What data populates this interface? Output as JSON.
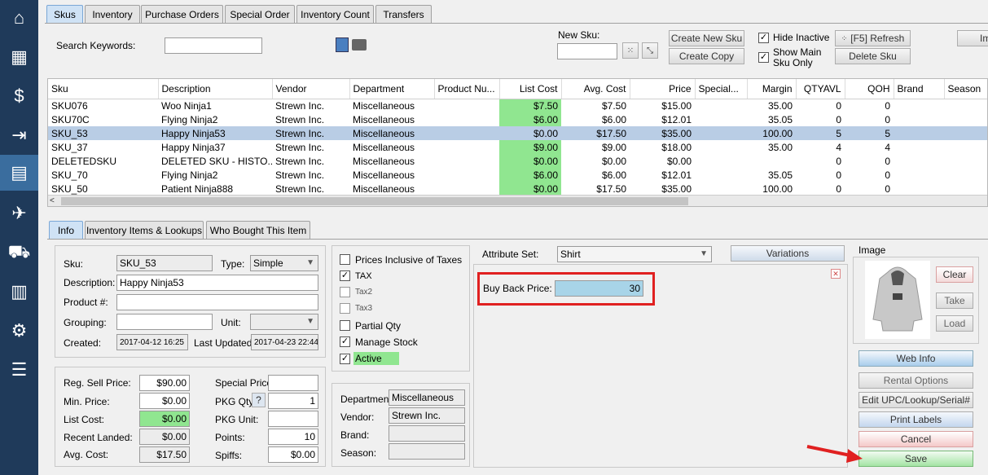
{
  "sidebar": {
    "items": [
      {
        "icon": "home-icon"
      },
      {
        "icon": "cash-register-icon"
      },
      {
        "icon": "invoice-icon"
      },
      {
        "icon": "sign-out-icon"
      },
      {
        "icon": "inventory-grid-icon"
      },
      {
        "icon": "walking-person-icon"
      },
      {
        "icon": "delivery-cart-icon"
      },
      {
        "icon": "report-icon"
      },
      {
        "icon": "settings-gears-icon"
      },
      {
        "icon": "menu-icon"
      }
    ]
  },
  "top_tabs": [
    "Skus",
    "Inventory",
    "Purchase Orders",
    "Special Order",
    "Inventory Count",
    "Transfers"
  ],
  "search": {
    "label": "Search Keywords:",
    "value": ""
  },
  "new_sku": {
    "label": "New Sku:",
    "value": ""
  },
  "toolbar": {
    "create_new_sku": "Create New Sku",
    "create_copy": "Create Copy",
    "hide_inactive": "Hide Inactive",
    "show_main_line1": "Show Main",
    "show_main_line2": "Sku Only",
    "refresh": "[F5] Refresh",
    "delete_sku": "Delete Sku",
    "import": "Imp"
  },
  "grid": {
    "columns": [
      "Sku",
      "Description",
      "Vendor",
      "Department",
      "Product Nu...",
      "List Cost",
      "Avg. Cost",
      "Price",
      "Special...",
      "Margin",
      "QTYAVL",
      "QOH",
      "Brand",
      "Season"
    ],
    "rows": [
      [
        "SKU076",
        "Woo Ninja1",
        "Strewn Inc.",
        "Miscellaneous",
        "",
        "$7.50",
        "$7.50",
        "$15.00",
        "",
        "35.00",
        "0",
        "0",
        "",
        ""
      ],
      [
        "SKU70C",
        "Flying Ninja2",
        "Strewn Inc.",
        "Miscellaneous",
        "",
        "$6.00",
        "$6.00",
        "$12.01",
        "",
        "35.05",
        "0",
        "0",
        "",
        ""
      ],
      [
        "SKU_53",
        "Happy Ninja53",
        "Strewn Inc.",
        "Miscellaneous",
        "",
        "$0.00",
        "$17.50",
        "$35.00",
        "",
        "100.00",
        "5",
        "5",
        "",
        ""
      ],
      [
        "SKU_37",
        "Happy Ninja37",
        "Strewn Inc.",
        "Miscellaneous",
        "",
        "$9.00",
        "$9.00",
        "$18.00",
        "",
        "35.00",
        "4",
        "4",
        "",
        ""
      ],
      [
        "DELETEDSKU",
        "DELETED SKU - HISTO...",
        "Strewn Inc.",
        "Miscellaneous",
        "",
        "$0.00",
        "$0.00",
        "$0.00",
        "",
        "",
        "0",
        "0",
        "",
        ""
      ],
      [
        "SKU_70",
        "Flying Ninja2",
        "Strewn Inc.",
        "Miscellaneous",
        "",
        "$6.00",
        "$6.00",
        "$12.01",
        "",
        "35.05",
        "0",
        "0",
        "",
        ""
      ],
      [
        "SKU_50",
        "Patient Ninja888",
        "Strewn Inc.",
        "Miscellaneous",
        "",
        "$0.00",
        "$17.50",
        "$35.00",
        "",
        "100.00",
        "0",
        "0",
        "",
        ""
      ]
    ],
    "selected_row": 2
  },
  "detail_tabs": [
    "Info",
    "Inventory Items & Lookups",
    "Who Bought This Item"
  ],
  "info": {
    "sku_label": "Sku:",
    "sku": "SKU_53",
    "type_label": "Type:",
    "type": "Simple",
    "description_label": "Description:",
    "description": "Happy Ninja53",
    "product_label": "Product #:",
    "product": "",
    "grouping_label": "Grouping:",
    "grouping": "",
    "unit_label": "Unit:",
    "unit": "",
    "created_label": "Created:",
    "created": "2017-04-12 16:25",
    "updated_label": "Last Updated:",
    "updated": "2017-04-23 22:44"
  },
  "pricing": {
    "reg_sell_label": "Reg. Sell Price:",
    "reg_sell": "$90.00",
    "min_price_label": "Min. Price:",
    "min_price": "$0.00",
    "list_cost_label": "List Cost:",
    "list_cost": "$0.00",
    "recent_landed_label": "Recent Landed:",
    "recent_landed": "$0.00",
    "avg_cost_label": "Avg. Cost:",
    "avg_cost": "$17.50",
    "special_price_label": "Special Price:",
    "special_price": "",
    "pkg_qty_label": "PKG Qty:",
    "pkg_qty": "1",
    "pkg_unit_label": "PKG Unit:",
    "pkg_unit": "",
    "points_label": "Points:",
    "points": "10",
    "spiffs_label": "Spiffs:",
    "spiffs": "$0.00",
    "help": "?"
  },
  "flags": [
    {
      "label": "Prices Inclusive of Taxes",
      "checked": false
    },
    {
      "label": "TAX",
      "checked": true
    },
    {
      "label": "Tax2",
      "checked": false
    },
    {
      "label": "Tax3",
      "checked": false
    },
    {
      "label": "Partial Qty",
      "checked": false
    },
    {
      "label": "Manage Stock",
      "checked": true
    },
    {
      "label": "Active",
      "checked": true
    }
  ],
  "vendor_info": {
    "department_label": "Department:",
    "department": "Miscellaneous",
    "vendor_label": "Vendor:",
    "vendor": "Strewn Inc.",
    "brand_label": "Brand:",
    "brand": "",
    "season_label": "Season:",
    "season": ""
  },
  "attributes": {
    "set_label": "Attribute Set:",
    "set": "Shirt",
    "variations": "Variations",
    "buy_back_label": "Buy Back Price:",
    "buy_back": "30"
  },
  "image_panel": {
    "label": "Image",
    "clear": "Clear",
    "take": "Take",
    "load": "Load"
  },
  "actions": {
    "web_info": "Web Info",
    "rental_options": "Rental Options",
    "edit_upc": "Edit UPC/Lookup/Serial#",
    "print_labels": "Print Labels",
    "cancel": "Cancel",
    "save": "Save"
  },
  "colors": {
    "sidebar": "#1f3a5a",
    "highlight_red": "#e02020",
    "green": "#90e690",
    "buy_back_fill": "#a8d4e8"
  }
}
